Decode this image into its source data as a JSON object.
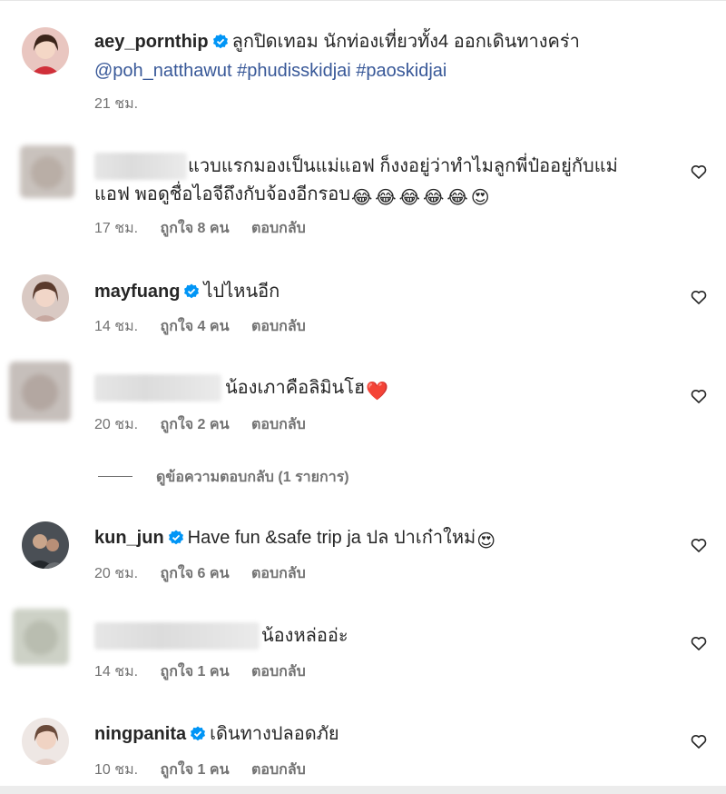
{
  "post": {
    "username": "aey_pornthip",
    "caption": "ลูกปิดเทอม นักท่องเที่ยวทั้ง4 ออกเดินทางคร่า",
    "mention": "@poh_natthawut",
    "hashtags": [
      "#phudisskidjai",
      "#paoskidjai"
    ],
    "time": "21 ชม."
  },
  "comments": [
    {
      "text_line1": "แวบแรกมองเป็นแม่แอฟ ก็งงอยู่ว่าทำไมลูกพี่ป๋ออยู่กับแม่",
      "text_line2": "แอฟ พอดูชื่อไอจีถึงกับจ้องอีกรอบ",
      "emojis": "😂😂😂😂😂😍",
      "time": "17 ชม.",
      "likes": "ถูกใจ 8 คน",
      "reply": "ตอบกลับ"
    },
    {
      "username": "mayfuang",
      "text": "ไปไหนอีก",
      "time": "14 ชม.",
      "likes": "ถูกใจ 4 คน",
      "reply": "ตอบกลับ"
    },
    {
      "text": "น้องเภาคือลิมินโฮ",
      "emoji": "❤️",
      "time": "20 ชม.",
      "likes": "ถูกใจ 2 คน",
      "reply": "ตอบกลับ",
      "view_replies": "ดูข้อความตอบกลับ (1 รายการ)"
    },
    {
      "username": "kun_jun",
      "text": "Have fun &safe trip ja ปล ปาเก๋าใหม่",
      "emoji": "😍",
      "time": "20 ชม.",
      "likes": "ถูกใจ 6 คน",
      "reply": "ตอบกลับ"
    },
    {
      "text": "น้องหล่ออ่ะ",
      "time": "14 ชม.",
      "likes": "ถูกใจ 1 คน",
      "reply": "ตอบกลับ"
    },
    {
      "username": "ningpanita",
      "text": "เดินทางปลอดภัย",
      "time": "10 ชม.",
      "likes": "ถูกใจ 1 คน",
      "reply": "ตอบกลับ"
    }
  ],
  "colors": {
    "link": "#385898",
    "verified": "#0095f6",
    "meta": "#737373"
  },
  "icons": {
    "verified": "verified-badge-icon",
    "like": "heart-outline-icon"
  }
}
